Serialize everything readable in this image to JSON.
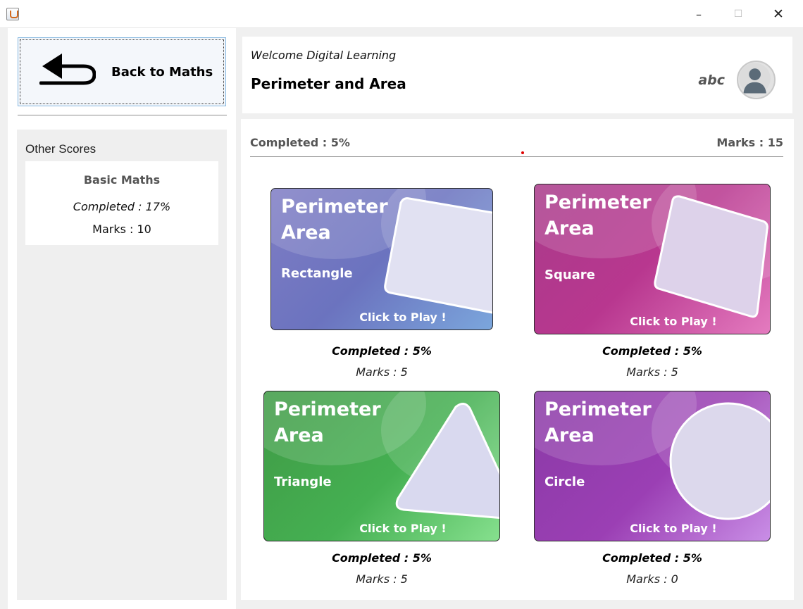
{
  "window": {
    "minimize": "–",
    "maximize": "☐",
    "close": "✕",
    "app_icon": "java-cup-icon"
  },
  "sidebar": {
    "back_label": "Back to Maths",
    "back_icon": "back-arrow-icon",
    "other_scores_title": "Other Scores",
    "scores": [
      {
        "name": "Basic Maths",
        "completed": "Completed : 17%",
        "marks": "Marks : 10"
      }
    ]
  },
  "header": {
    "welcome": "Welcome Digital Learning",
    "title": "Perimeter and Area",
    "username": "abc",
    "avatar_icon": "user-avatar-icon"
  },
  "progress": {
    "completed": "Completed : 5%",
    "marks": "Marks : 15"
  },
  "games": [
    {
      "line1": "Perimeter",
      "line2": "Area",
      "shape": "Rectangle",
      "play": "Click to Play !",
      "completed": "Completed : 5%",
      "marks": "Marks : 5",
      "color": "#6f72bd"
    },
    {
      "line1": "Perimeter",
      "line2": "Area",
      "shape": "Square",
      "play": "Click to Play !",
      "completed": "Completed : 5%",
      "marks": "Marks : 5",
      "color": "#c13f94"
    },
    {
      "line1": "Perimeter",
      "line2": "Area",
      "shape": "Triangle",
      "play": "Click to Play !",
      "completed": "Completed : 5%",
      "marks": "Marks : 5",
      "color": "#47a84a"
    },
    {
      "line1": "Perimeter",
      "line2": "Area",
      "shape": "Circle",
      "play": "Click to Play !",
      "completed": "Completed : 5%",
      "marks": "Marks : 0",
      "color": "#9a3db0"
    }
  ]
}
